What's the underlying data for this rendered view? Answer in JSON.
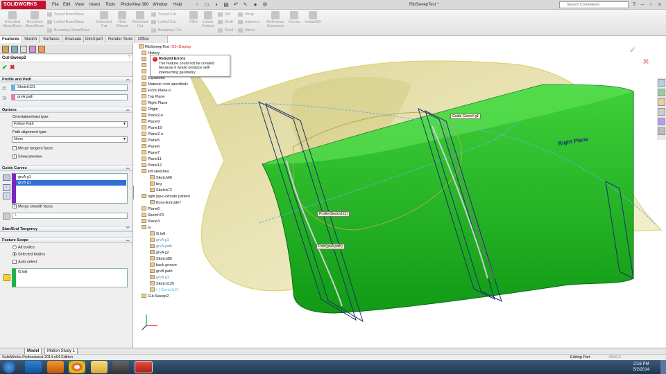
{
  "app": {
    "logo": "SOLIDWORKS",
    "document_title": "RibSweepTest *"
  },
  "menu": [
    "File",
    "Edit",
    "View",
    "Insert",
    "Tools",
    "PhotoView 360",
    "Window",
    "Help"
  ],
  "search": {
    "placeholder": "Search Commands"
  },
  "commands": {
    "extruded_boss": "Extruded Boss/Base",
    "revolved_boss": "Revolved Boss/Base",
    "swept_boss": "Swept Boss/Base",
    "lofted_boss": "Lofted Boss/Base",
    "boundary_boss": "Boundary Boss/Base",
    "extruded_cut": "Extruded Cut",
    "hole_wizard": "Hole Wizard",
    "revolved_cut": "Revolved Cut",
    "swept_cut": "Swept Cut",
    "lofted_cut": "Lofted Cut",
    "boundary_cut": "Boundary Cut",
    "fillet": "Fillet",
    "linear_pattern": "Linear Pattern",
    "rib": "Rib",
    "draft": "Draft",
    "shell": "Shell",
    "wrap": "Wrap",
    "intersect": "Intersect",
    "mirror": "Mirror",
    "reference_geometry": "Reference Geometry",
    "curves": "Curves",
    "instant3d": "Instant3D"
  },
  "cm_tabs": [
    "Features",
    "Sketch",
    "Surfaces",
    "Evaluate",
    "DimXpert",
    "Render Tools",
    "Office Products"
  ],
  "property_manager": {
    "title": "Cut-Sweep2",
    "profile_and_path": {
      "header": "Profile and Path",
      "profile": "Sketch121",
      "path": "grvA path"
    },
    "options": {
      "header": "Options",
      "orientation_label": "Orientation/twist type:",
      "orientation_value": "Follow Path",
      "path_alignment_label": "Path alignment type:",
      "path_alignment_value": "None",
      "merge_tangent": "Merge tangent faces",
      "show_preview": "Show preview"
    },
    "guide_curves": {
      "header": "Guide Curves",
      "items": [
        "grvA g1",
        "grvB g1"
      ],
      "merge_smooth": "Merge smooth faces",
      "spin_value": "1"
    },
    "start_end": {
      "header": "Start/End Tangency"
    },
    "feature_scope": {
      "header": "Feature Scope",
      "all_bodies": "All bodies",
      "selected_bodies": "Selected bodies",
      "auto_select": "Auto-select",
      "body": "G loft"
    }
  },
  "tree": {
    "root": "RibSweepTest",
    "root_suffix": "(S2<Display",
    "items": [
      {
        "label": "History",
        "style": "normal"
      },
      {
        "label": "",
        "style": "normal"
      },
      {
        "label": "",
        "style": "normal"
      },
      {
        "label": "",
        "style": "normal"
      },
      {
        "label": "Equations",
        "style": "normal"
      },
      {
        "label": "Material <not specified>",
        "style": "normal"
      },
      {
        "label": "Front Plane-o",
        "style": "normal"
      },
      {
        "label": "Top Plane",
        "style": "normal"
      },
      {
        "label": "Right Plane",
        "style": "normal"
      },
      {
        "label": "Origin",
        "style": "normal"
      },
      {
        "label": "Plane2-o",
        "style": "normal"
      },
      {
        "label": "Plane9",
        "style": "normal"
      },
      {
        "label": "Plane18",
        "style": "normal"
      },
      {
        "label": "Plane2-o",
        "style": "normal"
      },
      {
        "label": "Plane5",
        "style": "normal"
      },
      {
        "label": "Plane6",
        "style": "normal"
      },
      {
        "label": "Plane7",
        "style": "normal"
      },
      {
        "label": "Plane11",
        "style": "normal"
      },
      {
        "label": "Plane12",
        "style": "normal"
      },
      {
        "label": "loft sketches",
        "style": "normal"
      },
      {
        "label": "Sketch66",
        "style": "normal"
      },
      {
        "label": "brg",
        "style": "normal"
      },
      {
        "label": "Sketch72",
        "style": "normal"
      },
      {
        "label": "right pipe extrude pattern",
        "style": "normal"
      },
      {
        "label": "Boss-Extrude7",
        "style": "normal"
      },
      {
        "label": "Plane6",
        "style": "normal"
      },
      {
        "label": "Sketch79",
        "style": "normal"
      },
      {
        "label": "Plane3",
        "style": "normal"
      },
      {
        "label": "G",
        "style": "normal"
      },
      {
        "label": "G loft",
        "style": "normal"
      },
      {
        "label": "grvA g1",
        "style": "blue"
      },
      {
        "label": "grvA path",
        "style": "blue"
      },
      {
        "label": "grvA g2",
        "style": "normal"
      },
      {
        "label": "Sketch85",
        "style": "normal"
      },
      {
        "label": "back groove",
        "style": "normal"
      },
      {
        "label": "grvB path",
        "style": "normal"
      },
      {
        "label": "grvB g1",
        "style": "blue"
      },
      {
        "label": "Sketch120",
        "style": "normal"
      },
      {
        "label": "(-) Sketch121",
        "style": "cyan"
      },
      {
        "label": "Cut-Sweep2",
        "style": "normal"
      }
    ]
  },
  "rebuild_tooltip": {
    "title": "Rebuild Errors",
    "message": "The feature could not be created because it would produce self-intersecting geometry."
  },
  "viewport_labels": {
    "guide": "Guide Curve#-g1",
    "profile": "Profile(Sketch121)",
    "path": "Path(grvA path)",
    "plane": "Right Plane"
  },
  "bottom_tabs": [
    "Model",
    "Motion Study 1"
  ],
  "status": {
    "left": "SolidWorks Professional 2014 x64 Edition",
    "mode": "Editing Part",
    "units": "MMGS"
  },
  "clock": {
    "time": "2:16 PM",
    "date": "5/2/2014"
  },
  "colors": {
    "accent_red": "#c8102e",
    "body_green": "#2fbf2a",
    "preview_yellow": "#e8e089",
    "section_blue": "#dde3ea"
  }
}
